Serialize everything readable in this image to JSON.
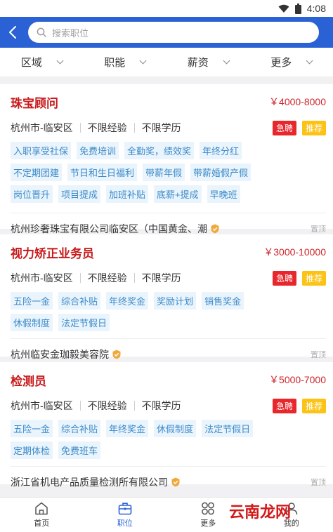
{
  "status": {
    "time": "4:08"
  },
  "search": {
    "placeholder": "搜索职位"
  },
  "filters": [
    {
      "label": "区域"
    },
    {
      "label": "职能"
    },
    {
      "label": "薪资"
    },
    {
      "label": "更多"
    }
  ],
  "jobs": [
    {
      "title": "珠宝顾问",
      "salary": "￥4000-8000",
      "location": "杭州市-临安区",
      "experience": "不限经验",
      "education": "不限学历",
      "badges": [
        "急聘",
        "推荐"
      ],
      "tags": [
        "入职享受社保",
        "免费培训",
        "全勤奖，绩效奖",
        "年终分红",
        "不定期团建",
        "节日和生日福利",
        "带薪年假",
        "带薪婚假产假",
        "岗位晋升",
        "项目提成",
        "加班补贴",
        "底薪+提成",
        "早晚班"
      ],
      "company": "杭州珍奢珠宝有限公司临安区（中国黄金、潮",
      "pin_label": "置顶"
    },
    {
      "title": "视力矫正业务员",
      "salary": "￥3000-10000",
      "location": "杭州市-临安区",
      "experience": "不限经验",
      "education": "不限学历",
      "badges": [
        "急聘",
        "推荐"
      ],
      "tags": [
        "五险一金",
        "综合补贴",
        "年终奖金",
        "奖励计划",
        "销售奖金",
        "休假制度",
        "法定节假日"
      ],
      "company": "杭州临安金珈毅美容院",
      "pin_label": "置顶"
    },
    {
      "title": "检测员",
      "salary": "￥5000-7000",
      "location": "杭州市-临安区",
      "experience": "不限经验",
      "education": "不限学历",
      "badges": [
        "急聘",
        "推荐"
      ],
      "tags": [
        "五险一金",
        "综合补贴",
        "年终奖金",
        "休假制度",
        "法定节假日",
        "定期体检",
        "免费班车"
      ],
      "company": "浙江省机电产品质量检测所有限公司",
      "pin_label": "置顶"
    }
  ],
  "tabbar": [
    {
      "label": "首页",
      "icon": "home-icon"
    },
    {
      "label": "职位",
      "icon": "briefcase-icon",
      "active": true
    },
    {
      "label": "更多",
      "icon": "grid-icon"
    },
    {
      "label": "我的",
      "icon": "user-icon"
    }
  ],
  "watermark": {
    "text": "云南龙网"
  },
  "colors": {
    "brand": "#2a62d6",
    "title_red": "#c8191b",
    "urgent": "#e8272d",
    "recommend": "#fcc316",
    "tag_text": "#3a8ac8",
    "tag_bg": "#eaf4fd"
  }
}
